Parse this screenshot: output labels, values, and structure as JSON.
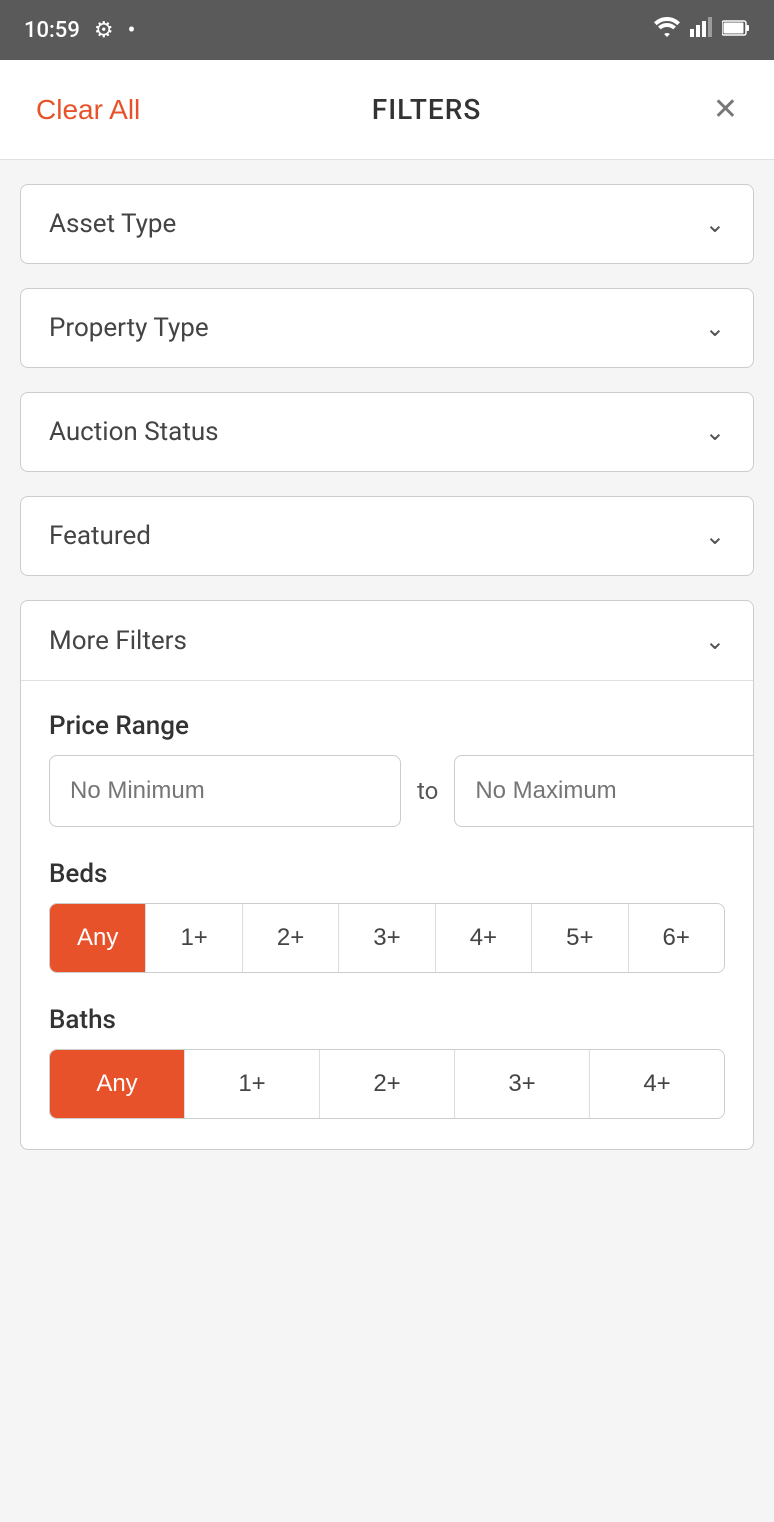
{
  "statusBar": {
    "time": "10:59",
    "gearIcon": "⚙",
    "dot": "•",
    "wifi": "wifi-icon",
    "signal": "signal-icon",
    "battery": "battery-icon"
  },
  "header": {
    "clearAll": "Clear All",
    "title": "FILTERS",
    "closeIcon": "✕"
  },
  "dropdowns": [
    {
      "label": "Asset Type"
    },
    {
      "label": "Property Type"
    },
    {
      "label": "Auction Status"
    },
    {
      "label": "Featured"
    }
  ],
  "moreFilters": {
    "label": "More Filters",
    "priceRange": {
      "label": "Price Range",
      "minPlaceholder": "No Minimum",
      "to": "to",
      "maxPlaceholder": "No Maximum"
    },
    "beds": {
      "label": "Beds",
      "options": [
        "Any",
        "1+",
        "2+",
        "3+",
        "4+",
        "5+",
        "6+"
      ],
      "activeIndex": 0
    },
    "baths": {
      "label": "Baths",
      "options": [
        "Any",
        "1+",
        "2+",
        "3+",
        "4+"
      ],
      "activeIndex": 0
    }
  }
}
